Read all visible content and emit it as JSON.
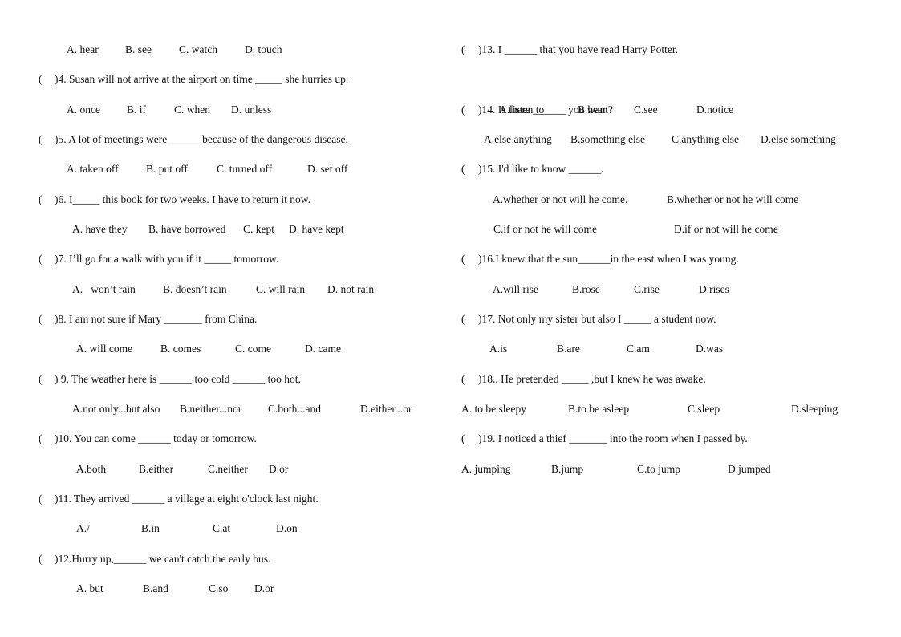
{
  "document": {
    "type": "English multiple-choice worksheet",
    "left_column": {
      "leading_options": {
        "A": "A. hear",
        "B": "B. see",
        "C": "C. watch",
        "D": "D. touch"
      },
      "questions": [
        {
          "number": "4",
          "paren": "(",
          "stem_prefix": ")4. Susan will not arrive at the airport on time ",
          "blank": "_____",
          "stem_suffix": " she hurries up.",
          "options": {
            "A": "A. once",
            "B": "B. if",
            "C": "C. when",
            "D": "D. unless"
          }
        },
        {
          "number": "5",
          "paren": "(",
          "stem_prefix": ")5. A lot of meetings were",
          "blank": "______",
          "stem_suffix": " because of the dangerous disease.",
          "options": {
            "A": "A. taken off",
            "B": "B. put off",
            "C": "C. turned off",
            "D": "D. set off"
          }
        },
        {
          "number": "6",
          "paren": "(",
          "stem_prefix": ")6. I",
          "blank": "_____",
          "stem_suffix": " this book for two weeks. I have to return it now.",
          "options": {
            "A": "A. have they",
            "B": "B. have borrowed",
            "C": "C. kept",
            "D": "D. have kept"
          }
        },
        {
          "number": "7",
          "paren": "(",
          "stem_prefix": ")7. I’ll go for a walk with you if it ",
          "blank": "_____",
          "stem_suffix": " tomorrow.",
          "options": {
            "A": "A.   won’t rain",
            "B": "B. doesn’t rain",
            "C": "C. will rain",
            "D": "D. not rain"
          }
        },
        {
          "number": "8",
          "paren": "(",
          "stem_prefix": ")8. I am not sure if Mary ",
          "blank": "_______",
          "stem_suffix": " from China.",
          "options": {
            "A": "A. will come",
            "B": "B. comes",
            "C": "C. come",
            "D": "D. came"
          }
        },
        {
          "number": "9",
          "paren": "(",
          "stem_prefix": ") 9. The weather here is ",
          "blank": "______",
          "stem_mid": " too cold ",
          "blank2": "______",
          "stem_suffix": " too hot.",
          "options": {
            "A": "A.not only...but also",
            "B": "B.neither...nor",
            "C": "C.both...and",
            "D": "D.either...or"
          }
        },
        {
          "number": "10",
          "paren": "(",
          "stem_prefix": ")10. You can come ",
          "blank": "______",
          "stem_suffix": " today or tomorrow.",
          "options": {
            "A": "A.both",
            "B": "B.either",
            "C": "C.neither",
            "D": "D.or"
          }
        },
        {
          "number": "11",
          "paren": "(",
          "stem_prefix": ")11. They arrived ",
          "blank": "______",
          "stem_suffix": " a village at eight o'clock last night.",
          "options": {
            "A": "A./",
            "B": "B.in",
            "C": "C.at",
            "D": "D.on"
          }
        },
        {
          "number": "12",
          "paren": "(",
          "stem_prefix": ")12.Hurry up,",
          "blank": "______",
          "stem_suffix": " we can't catch the early bus.",
          "options": {
            "A": "A. but",
            "B": "B.and",
            "C": "C.so",
            "D": "D.or"
          }
        }
      ]
    },
    "right_column": {
      "questions": [
        {
          "number": "13",
          "paren": "(",
          "stem_prefix": ")13. I ",
          "blank": "______",
          "stem_suffix": " that you have read Harry Potter.",
          "options": {
            "A": "A.listen to",
            "B": "B.hear",
            "C": "C.see",
            "D": "D.notice"
          }
        },
        {
          "number": "14",
          "paren": "(",
          "stem_prefix": ")14. Is there ",
          "blank": "______",
          "stem_suffix": " you want?",
          "options": {
            "A": "A.else anything",
            "B": "B.something else",
            "C": "C.anything else",
            "D": "D.else something"
          }
        },
        {
          "number": "15",
          "paren": "(",
          "stem_prefix": ")15. I'd like to know ",
          "blank": "______",
          "stem_suffix": ".",
          "options": {
            "A": "A.whether or not will he come.",
            "B": "B.whether or not he will come",
            "C": "C.if or not he will come",
            "D": "D.if or not will he come"
          }
        },
        {
          "number": "16",
          "paren": "(",
          "stem_prefix": ")16.I knew that the sun",
          "blank": "______",
          "stem_suffix": "in the east when I was young.",
          "options": {
            "A": "A.will rise",
            "B": "B.rose",
            "C": "C.rise",
            "D": "D.rises"
          }
        },
        {
          "number": "17",
          "paren": "(",
          "stem_prefix": ")17. Not only my sister but also I ",
          "blank": "_____",
          "stem_suffix": " a student now.",
          "options": {
            "A": "A.is",
            "B": "B.are",
            "C": "C.am",
            "D": "D.was"
          }
        },
        {
          "number": "18",
          "paren": "(",
          "stem_prefix": ")18.. He pretended ",
          "blank": "_____",
          "stem_suffix": " ,but I knew he was awake.",
          "options": {
            "A": "A. to be sleepy",
            "B": "B.to be asleep",
            "C": "C.sleep",
            "D": "D.sleeping"
          }
        },
        {
          "number": "19",
          "paren": "(",
          "stem_prefix": ")19. I noticed a thief ",
          "blank": "_______",
          "stem_suffix": " into the room when I passed by.",
          "options": {
            "A": "A. jumping",
            "B": "B.jump",
            "C": "C.to jump",
            "D": "D.jumped"
          }
        }
      ]
    }
  }
}
